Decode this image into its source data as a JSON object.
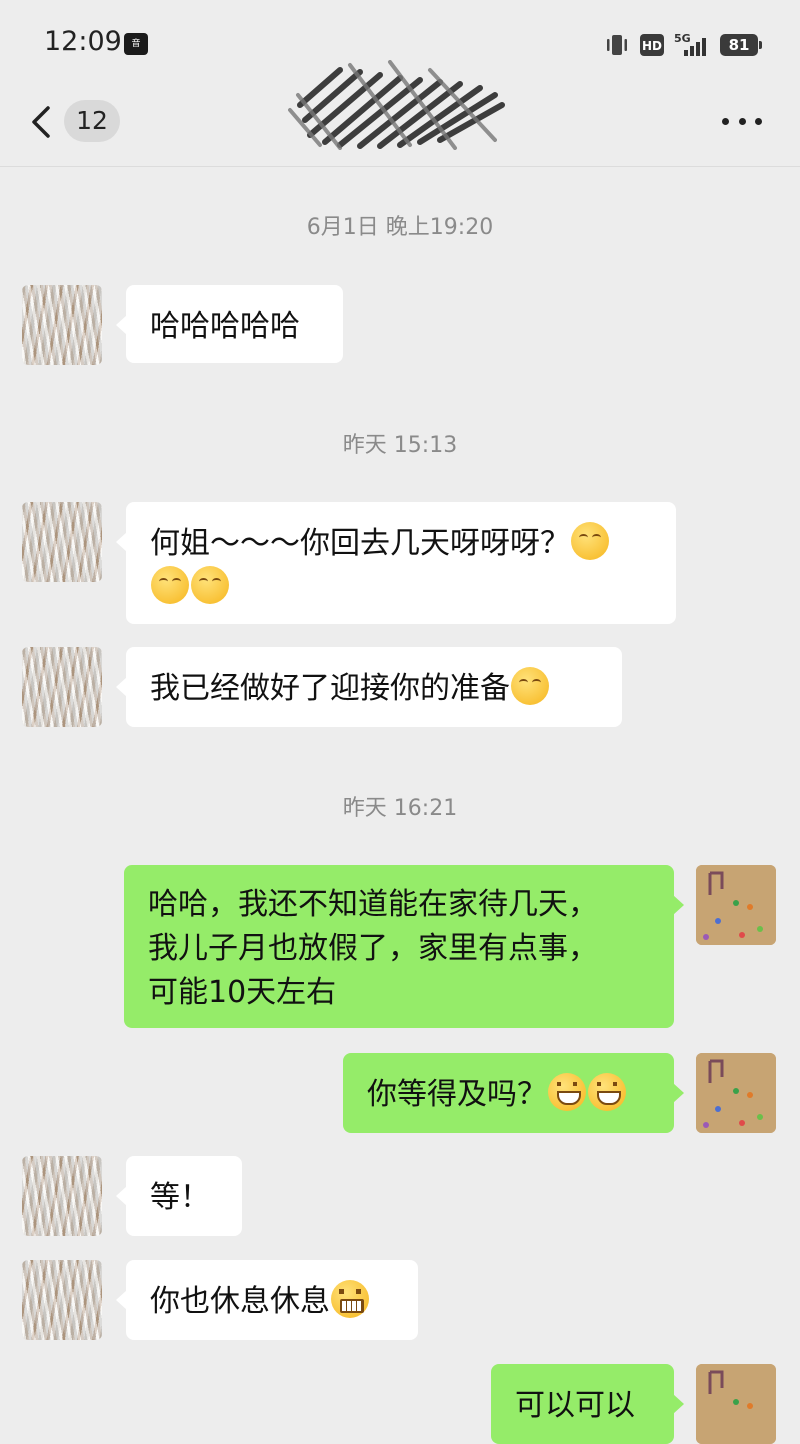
{
  "status": {
    "time": "12:09",
    "app_badge": "音",
    "hd": "HD",
    "network": "5G",
    "battery": "81"
  },
  "nav": {
    "unread_count": "12"
  },
  "messages": {
    "ts1": "6月1日 晚上19:20",
    "m1": "哈哈哈哈哈",
    "ts2": "昨天 15:13",
    "m2": "何姐～～～你回去几天呀呀呀？",
    "m3": "我已经做好了迎接你的准备",
    "ts3": "昨天 16:21",
    "m4_l1": "哈哈，我还不知道能在家待几天，",
    "m4_l2": "我儿子月也放假了，家里有点事，",
    "m4_l3": "可能10天左右",
    "m5": "你等得及吗？",
    "m6": "等！",
    "m7": "你也休息休息",
    "m8": "可以可以"
  },
  "colors": {
    "background": "#ededed",
    "incoming_bubble": "#ffffff",
    "outgoing_bubble": "#95ec69"
  }
}
